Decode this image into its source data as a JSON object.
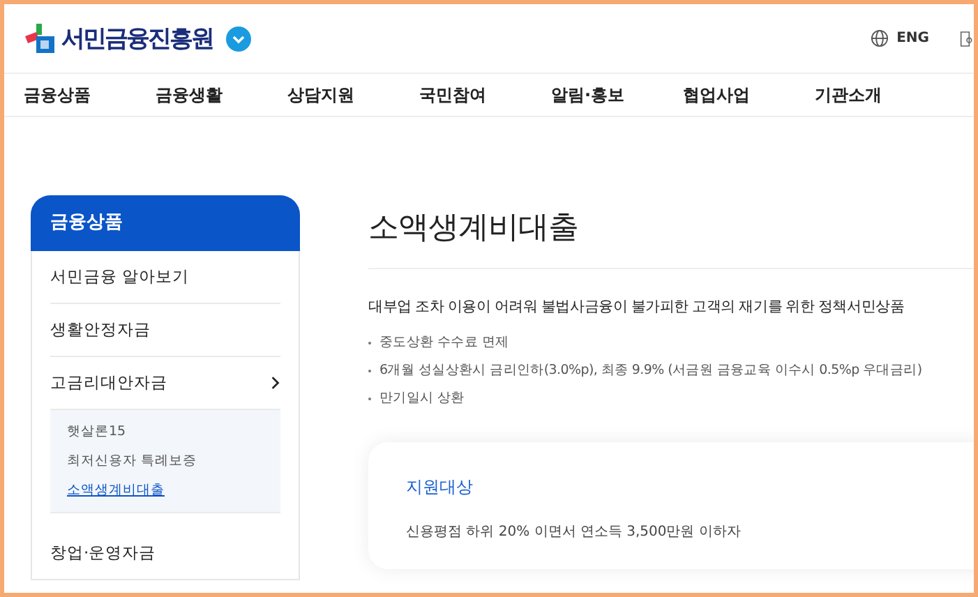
{
  "header": {
    "logo_text": "서민금융진흥원",
    "language": "ENG"
  },
  "nav": [
    {
      "label": "금융상품",
      "selected": false
    },
    {
      "label": "금융생활",
      "selected": false
    },
    {
      "label": "상담지원",
      "selected": false
    },
    {
      "label": "국민참여",
      "selected": false
    },
    {
      "label": "알림·홍보",
      "selected": false
    },
    {
      "label": "협업사업",
      "selected": false
    },
    {
      "label": "기관소개",
      "selected": false
    }
  ],
  "sidebar": {
    "title": "금융상품",
    "items": [
      {
        "label": "서민금융 알아보기",
        "expanded": false
      },
      {
        "label": "생활안정자금",
        "expanded": false
      },
      {
        "label": "고금리대안자금",
        "expanded": true,
        "children": [
          {
            "label": "햇살론15",
            "selected": false
          },
          {
            "label": "최저신용자 특례보증",
            "selected": false
          },
          {
            "label": "소액생계비대출",
            "selected": true
          }
        ]
      },
      {
        "label": "창업·운영자금",
        "expanded": false
      }
    ]
  },
  "page": {
    "title": "소액생계비대출",
    "summary": "대부업 조차 이용이 어려워 불법사금융이 불가피한 고객의 재기를 위한 정책서민상품",
    "bullets": [
      "중도상환 수수료 면제",
      "6개월 성실상환시 금리인하(3.0%p), 최종 9.9% (서금원 금융교육 이수시 0.5%p 우대금리)",
      "만기일시 상환"
    ],
    "card": {
      "heading": "지원대상",
      "text": "신용평점 하위 20% 이면서 연소득 3,500만원 이하자"
    }
  }
}
